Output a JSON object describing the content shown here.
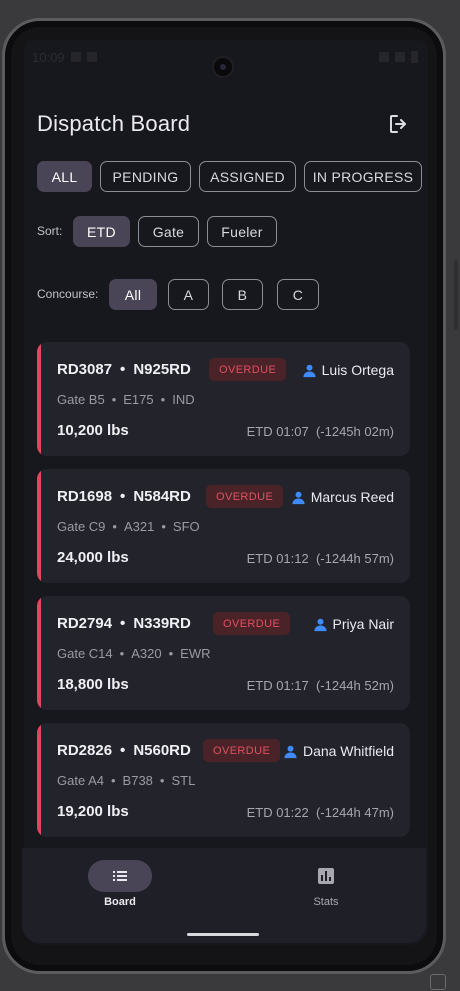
{
  "status_bar": {
    "time": "10:09",
    "icons": [
      "sim-icon",
      "clipboard-icon",
      "wifi-icon",
      "signal-icon",
      "battery-icon"
    ]
  },
  "header": {
    "title": "Dispatch Board",
    "logout_icon": "logout-icon"
  },
  "status_filters": [
    {
      "label": "ALL",
      "active": true
    },
    {
      "label": "PENDING",
      "active": false
    },
    {
      "label": "ASSIGNED",
      "active": false
    },
    {
      "label": "IN PROGRESS",
      "active": false
    }
  ],
  "sort": {
    "label": "Sort:",
    "options": [
      {
        "label": "ETD",
        "active": true
      },
      {
        "label": "Gate",
        "active": false
      },
      {
        "label": "Fueler",
        "active": false
      }
    ]
  },
  "concourse": {
    "label": "Concourse:",
    "options": [
      {
        "label": "All",
        "active": true
      },
      {
        "label": "A",
        "active": false
      },
      {
        "label": "B",
        "active": false
      },
      {
        "label": "C",
        "active": false
      }
    ]
  },
  "cards": [
    {
      "id": "RD3087",
      "tail": "N925RD",
      "badge": "OVERDUE",
      "assignee": "Luis Ortega",
      "gate": "Gate B5",
      "aircraft": "E175",
      "dest": "IND",
      "weight": "10,200 lbs",
      "etd": "ETD 01:07  (-1245h 02m)"
    },
    {
      "id": "RD1698",
      "tail": "N584RD",
      "badge": "OVERDUE",
      "assignee": "Marcus Reed",
      "gate": "Gate C9",
      "aircraft": "A321",
      "dest": "SFO",
      "weight": "24,000 lbs",
      "etd": "ETD 01:12  (-1244h 57m)"
    },
    {
      "id": "RD2794",
      "tail": "N339RD",
      "badge": "OVERDUE",
      "assignee": "Priya Nair",
      "gate": "Gate C14",
      "aircraft": "A320",
      "dest": "EWR",
      "weight": "18,800 lbs",
      "etd": "ETD 01:17  (-1244h 52m)"
    },
    {
      "id": "RD2826",
      "tail": "N560RD",
      "badge": "OVERDUE",
      "assignee": "Dana Whitfield",
      "gate": "Gate A4",
      "aircraft": "B738",
      "dest": "STL",
      "weight": "19,200 lbs",
      "etd": "ETD 01:22  (-1244h 47m)"
    }
  ],
  "bottom_nav": [
    {
      "label": "Board",
      "icon": "list-icon",
      "active": true
    },
    {
      "label": "Stats",
      "icon": "bar-chart-icon",
      "active": false
    }
  ],
  "colors": {
    "accent": "#4a4556",
    "overdue": "#e0475a",
    "background": "#17181d",
    "card": "#22232b"
  },
  "separator": "•"
}
